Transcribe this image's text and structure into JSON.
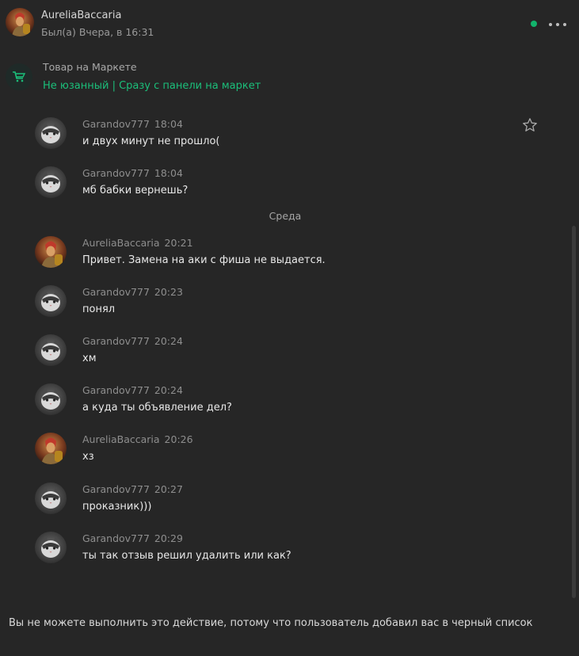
{
  "header": {
    "name": "AureliaBaccaria",
    "status": "Был(а) Вчера, в 16:31"
  },
  "market": {
    "title": "Товар на Маркете",
    "link": "Не юзанный | Сразу с панели на маркет"
  },
  "day_separator": "Среда",
  "messages": [
    {
      "author": "Garandov777",
      "time": "18:04",
      "text": "и двух минут не прошло(",
      "avatar": "cat-avatar"
    },
    {
      "author": "Garandov777",
      "time": "18:04",
      "text": "мб бабки вернешь?",
      "avatar": "cat-avatar"
    },
    {
      "author": "AureliaBaccaria",
      "time": "20:21",
      "text": "Привет. Замена на аки с фиша не выдается.",
      "avatar": "warrior-avatar"
    },
    {
      "author": "Garandov777",
      "time": "20:23",
      "text": "понял",
      "avatar": "cat-avatar"
    },
    {
      "author": "Garandov777",
      "time": "20:24",
      "text": "хм",
      "avatar": "cat-avatar"
    },
    {
      "author": "Garandov777",
      "time": "20:24",
      "text": "а куда ты объявление дел?",
      "avatar": "cat-avatar"
    },
    {
      "author": "AureliaBaccaria",
      "time": "20:26",
      "text": "хз",
      "avatar": "warrior-avatar"
    },
    {
      "author": "Garandov777",
      "time": "20:27",
      "text": "проказник)))",
      "avatar": "cat-avatar"
    },
    {
      "author": "Garandov777",
      "time": "20:29",
      "text": "ты так отзыв решил удалить или как?",
      "avatar": "cat-avatar"
    }
  ],
  "blocked_notice": "Вы не можете выполнить это действие, потому что пользователь добавил вас в черный список",
  "colors": {
    "background": "#262626",
    "accent": "#1bbf7a",
    "online": "#12b36b"
  }
}
